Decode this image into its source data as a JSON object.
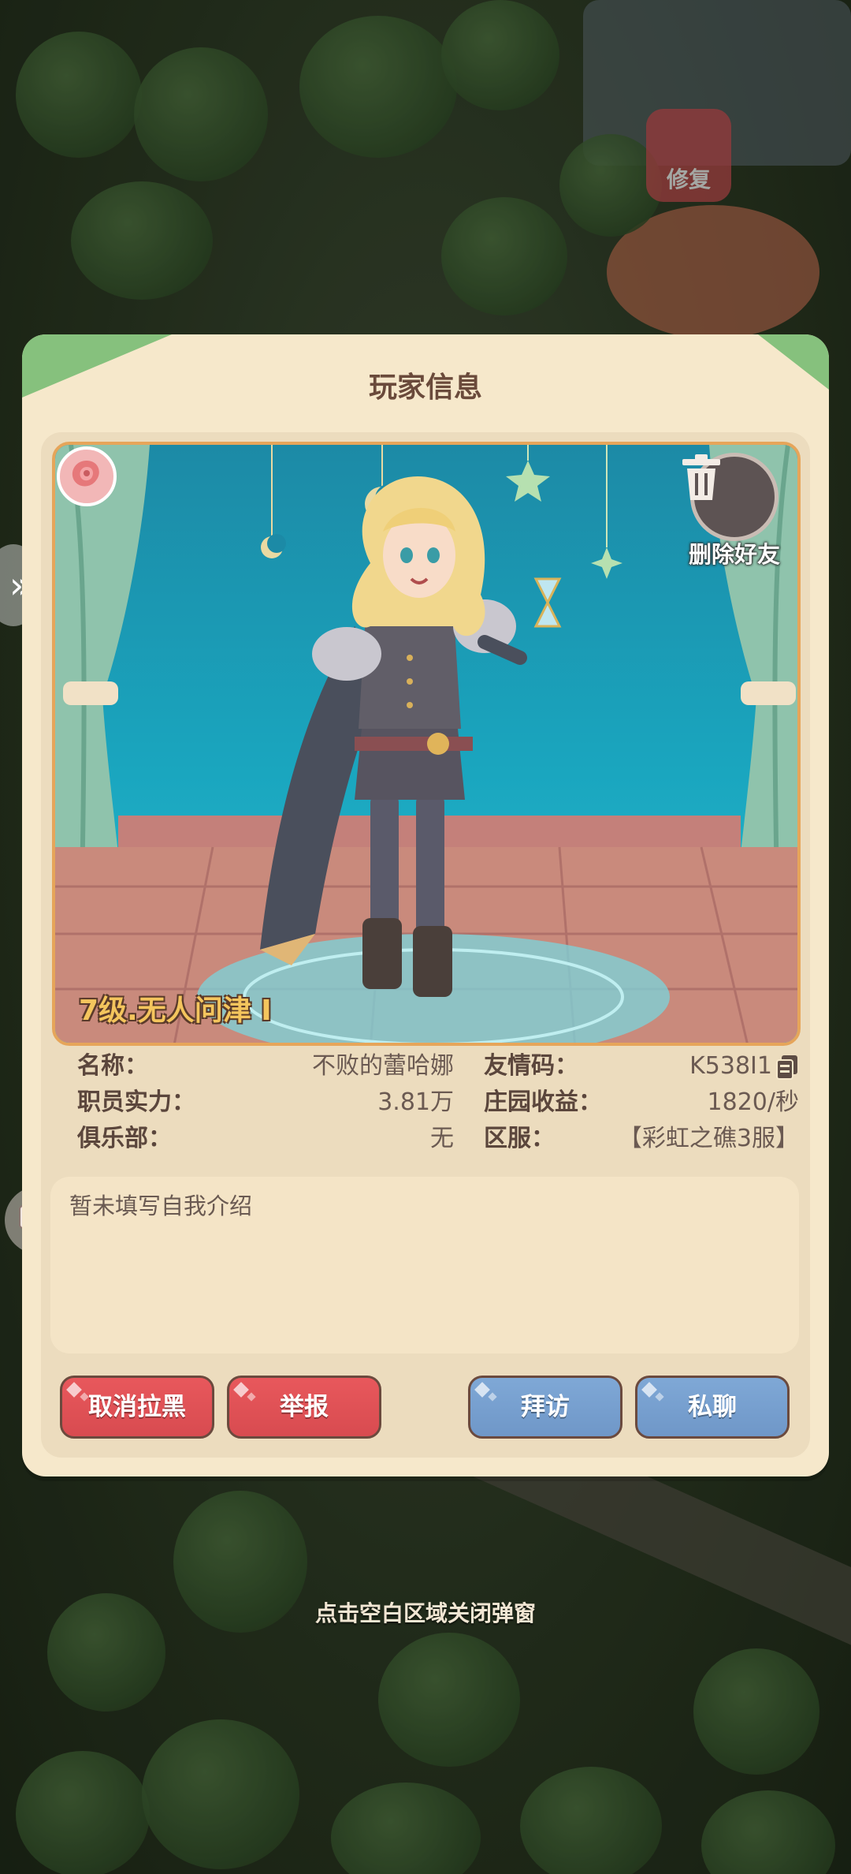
{
  "background": {
    "repair_label": "修复"
  },
  "modal": {
    "title": "玩家信息",
    "delete_friend_label": "删除好友",
    "level_label": "7级.无人问津 I",
    "info": {
      "name_key": "名称：",
      "name_value": "不败的蕾哈娜",
      "friend_code_key": "友情码：",
      "friend_code_value": "K538I1",
      "staff_power_key": "职员实力：",
      "staff_power_value": "3.81万",
      "estate_income_key": "庄园收益：",
      "estate_income_value": "1820/秒",
      "club_key": "俱乐部：",
      "club_value": "无",
      "server_key": "区服：",
      "server_value": "【彩虹之礁3服】"
    },
    "intro_text": "暂未填写自我介绍",
    "buttons": {
      "unblock": "取消拉黑",
      "report": "举报",
      "visit": "拜访",
      "private_chat": "私聊"
    },
    "colors": {
      "panel": "#f6e8cb",
      "red_button": "#e0525a",
      "blue_button": "#779fcf",
      "title_text": "#6a4a3b"
    }
  },
  "close_hint": "点击空白区域关闭弹窗"
}
